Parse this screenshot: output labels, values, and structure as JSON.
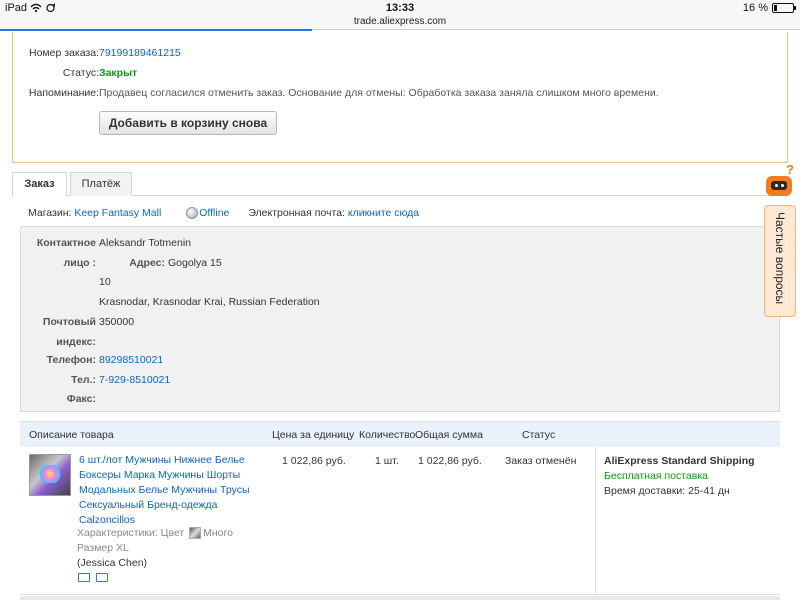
{
  "statusbar": {
    "device": "iPad",
    "time": "13:33",
    "url": "trade.aliexpress.com",
    "battery": "16 %",
    "battery_level": 0.16,
    "page_load_progress": 0.39
  },
  "notice": {
    "order_number_label": "Номер заказа:",
    "order_number": "79199189461215",
    "status_label": "Статус:",
    "status": "Закрыт",
    "reminder_label": "Напоминание:",
    "reminder": "Продавец согласился отменить заказ. Основание для отмены: Обработка заказа заняла слишком много времени.",
    "add_to_cart_button": "Добавить в корзину снова"
  },
  "tabs": [
    {
      "label": "Заказ",
      "active": true
    },
    {
      "label": "Платёж",
      "active": false
    }
  ],
  "shop": {
    "store_label": "Магазин:",
    "store_name": "Keep Fantasy Mall",
    "online_status": "Offline",
    "email_label": "Электронная почта:",
    "email_link": "кликните сюда"
  },
  "contact": {
    "person_label_1": "Контактное",
    "person_label_2": "лицо :",
    "person": "Aleksandr Totmenin",
    "address_label": "Адрес:",
    "address_line1": "Gogolya 15",
    "address_line2": "10",
    "address_line3": "Krasnodar, Krasnodar Krai, Russian Federation",
    "zip_label_1": "Почтовый",
    "zip_label_2": "индекс:",
    "zip": "350000",
    "phone_label": "Телефон:",
    "phone": "89298510021",
    "tel_label": "Тел.:",
    "tel": "7-929-8510021",
    "fax_label": "Факс:",
    "fax": ""
  },
  "table": {
    "headers": {
      "description": "Описание товара",
      "unit_price": "Цена за единицу",
      "quantity": "Количество",
      "total": "Общая сумма",
      "status": "Статус"
    },
    "item": {
      "title": "6 шт./лот Мужчины Нижнее Белье Боксеры Марка Мужчины Шорты Модальных Белье Мужчины Трусы Сексуальный Бренд-одежда Calzoncillos",
      "characteristics_label": "Характеристики: Цвет",
      "color_value": "Много",
      "size": "Размер XL",
      "seller": "(Jessica Chen)",
      "unit_price": "1 022,86 руб.",
      "quantity": "1 шт.",
      "total": "1 022,86 руб.",
      "status": "Заказ отменён"
    },
    "shipping": {
      "method": "AliExpress Standard Shipping",
      "cost": "Бесплатная поставка",
      "delivery_label": "Время доставки:",
      "delivery_time": "25-41 дн"
    }
  },
  "faq": {
    "label": "Частые вопросы",
    "icon_mark": "?"
  }
}
